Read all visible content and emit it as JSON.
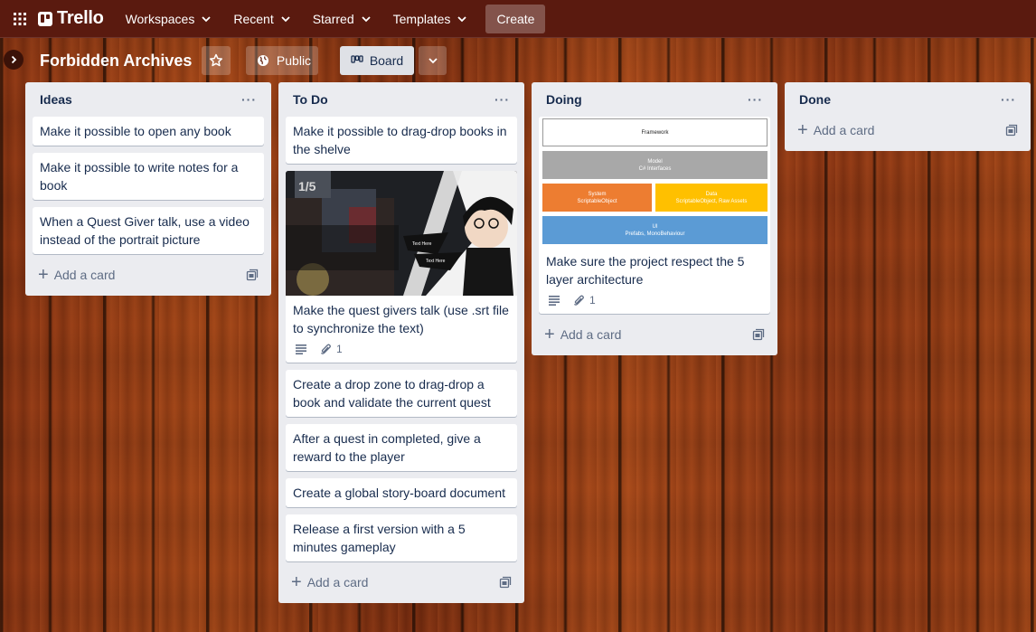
{
  "nav": {
    "logo": "Trello",
    "workspaces": "Workspaces",
    "recent": "Recent",
    "starred": "Starred",
    "templates": "Templates",
    "create": "Create"
  },
  "board": {
    "title": "Forbidden Archives",
    "visibility": "Public",
    "view": "Board"
  },
  "lists": [
    {
      "title": "Ideas",
      "cards": [
        "Make it possible to open any book",
        "Make it possible to write notes for a book",
        "When a Quest Giver talk, use a video instead of the portrait picture"
      ],
      "add_card": "Add a card"
    },
    {
      "title": "To Do",
      "cards": [
        "Make it possible to drag-drop books in the shelve",
        "Make the quest givers talk (use .srt file to synchronize the text)",
        "Create a drop zone to drag-drop a book and validate the current quest",
        "After a quest in completed, give a reward to the player",
        "Create a global story-board document",
        "Release a first version with a 5 minutes gameplay"
      ],
      "card_attachments": "1",
      "add_card": "Add a card"
    },
    {
      "title": "Doing",
      "cards": [
        "Make sure the project respect the 5 layer architecture"
      ],
      "card_attachments": "1",
      "add_card": "Add a card",
      "diagram": {
        "framework": "Framework",
        "model": "Model",
        "model_sub": "C# Interfaces",
        "system": "System",
        "system_sub": "ScriptableObject",
        "data": "Data",
        "data_sub": "ScriptableObject, Raw Assets",
        "ui": "UI",
        "ui_sub": "Prefabs, MonoBehaviour"
      }
    },
    {
      "title": "Done",
      "cards": [],
      "add_card": "Add a card"
    }
  ],
  "game_cover": {
    "bubble_1": "Text Here",
    "bubble_2": "Text Here"
  },
  "colors": {
    "nav_bg": "#5a1a0f",
    "list_bg": "#ebecf0",
    "diagram_gray": "#a8a8a8",
    "diagram_orange": "#ed7d31",
    "diagram_yellow": "#ffc000",
    "diagram_blue": "#5b9bd5"
  },
  "icons": [
    "apps-grid-icon",
    "chevron-down-icon",
    "star-icon",
    "globe-icon",
    "board-icon",
    "sidebar-expand-icon",
    "more-icon",
    "plus-icon",
    "template-icon",
    "description-icon",
    "paperclip-icon"
  ]
}
